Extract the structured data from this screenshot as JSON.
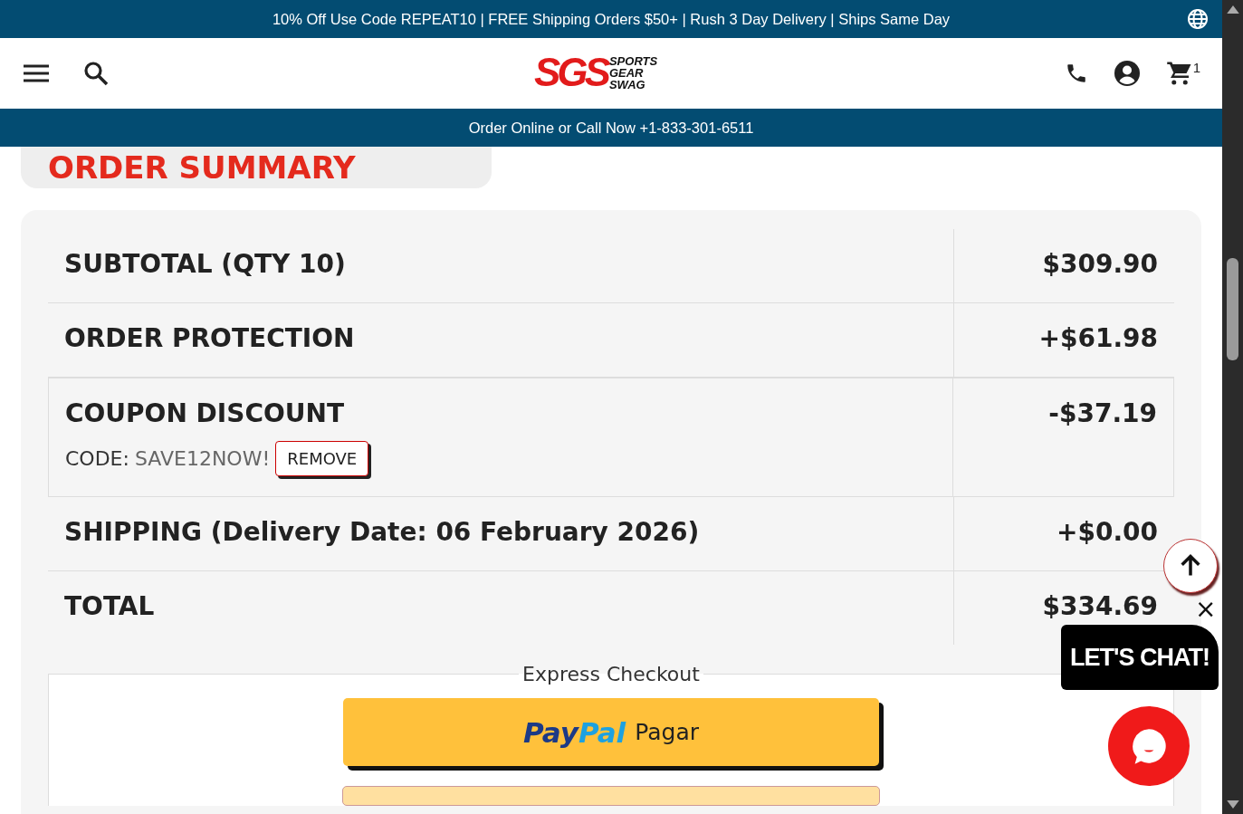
{
  "announcement": "10% Off Use Code REPEAT10 | FREE Shipping Orders $50+ | Rush 3 Day Delivery | Ships Same Day",
  "header": {
    "logo": {
      "mark": "SGS",
      "words": [
        "SPORTS",
        "GEAR",
        "SWAG"
      ]
    },
    "cart_count": "1"
  },
  "call_bar": "Order Online or Call Now +1-833-301-6511",
  "heading": "ORDER SUMMARY",
  "summary_rows": [
    {
      "kind": "plain",
      "label": "SUBTOTAL (QTY 10)",
      "value": "$309.90"
    },
    {
      "kind": "plain",
      "label": "ORDER PROTECTION",
      "value": "+$61.98"
    },
    {
      "kind": "coupon",
      "label": "COUPON DISCOUNT",
      "code_label": "CODE:",
      "code": "SAVE12NOW!",
      "action": "REMOVE",
      "value": "-$37.19"
    },
    {
      "kind": "plain",
      "label": "SHIPPING (Delivery Date: 06 February 2026)",
      "value": "+$0.00"
    },
    {
      "kind": "total",
      "label": "TOTAL",
      "value": "$334.69"
    }
  ],
  "express_checkout": {
    "legend": "Express Checkout",
    "paypal": {
      "brand_dark": "Pay",
      "brand_light": "Pal",
      "label": "Pagar"
    }
  },
  "chat": {
    "close": "×",
    "bubble": "LET'S CHAT!"
  }
}
